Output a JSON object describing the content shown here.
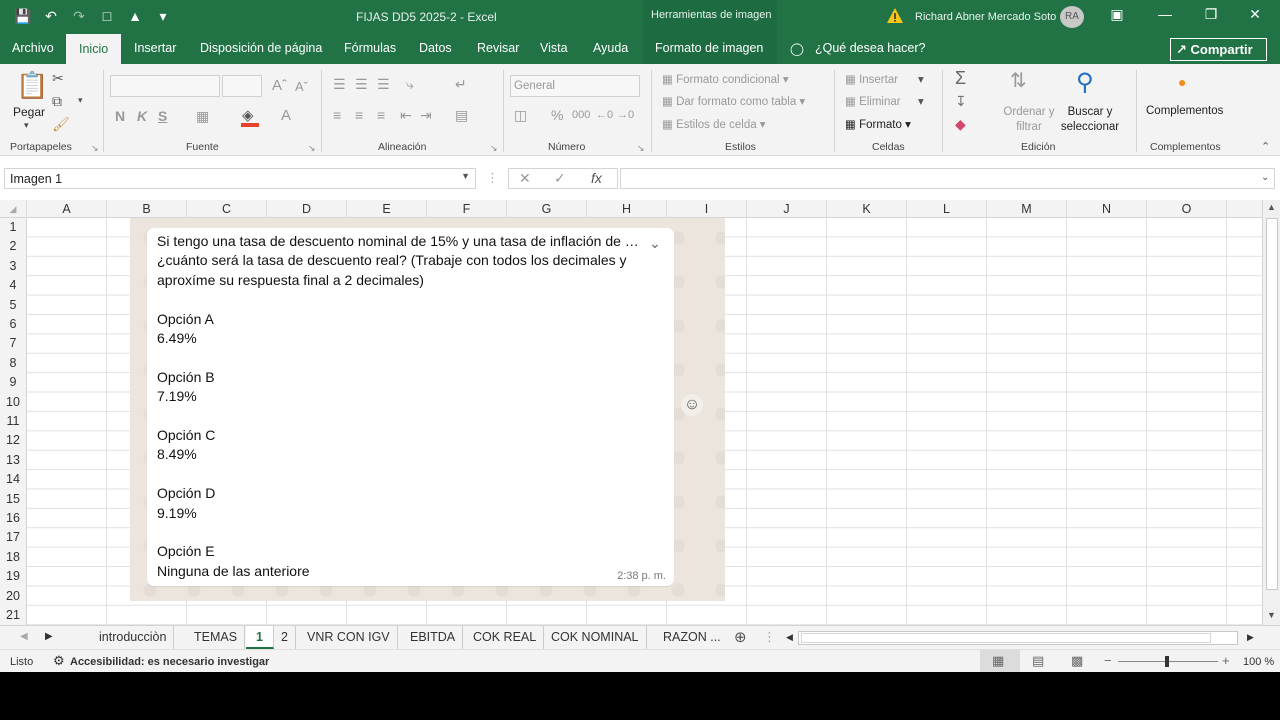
{
  "title_bar": {
    "document_title": "FIJAS DD5 2025-2  -  Excel",
    "contextual_tools": "Herramientas de imagen",
    "user_name": "Richard  Abner Mercado Soto",
    "user_initials": "RA"
  },
  "ribbon_tabs": [
    "Archivo",
    "Inicio",
    "Insertar",
    "Disposición de página",
    "Fórmulas",
    "Datos",
    "Revisar",
    "Vista",
    "Ayuda",
    "Formato de imagen"
  ],
  "tell_me": "¿Qué desea hacer?",
  "share_label": "Compartir",
  "ribbon": {
    "paste_label": "Pegar",
    "font_box": "",
    "number_format": "General",
    "styles": {
      "conditional": "Formato condicional",
      "as_table": "Dar formato como tabla",
      "cell_styles": "Estilos de celda"
    },
    "cells": {
      "insert": "Insertar",
      "delete": "Eliminar",
      "format": "Formato"
    },
    "editing": {
      "sort": "Ordenar y filtrar",
      "find": "Buscar y seleccionar"
    },
    "addins": "Complementos",
    "groups": [
      "Portapapeles",
      "Fuente",
      "Alineación",
      "Número",
      "Estilos",
      "Celdas",
      "Edición",
      "Complementos"
    ]
  },
  "formula_bar": {
    "name_box": "Imagen 1",
    "formula": ""
  },
  "columns": [
    "A",
    "B",
    "C",
    "D",
    "E",
    "F",
    "G",
    "H",
    "I",
    "J",
    "K",
    "L",
    "M",
    "N",
    "O"
  ],
  "rows": [
    "1",
    "2",
    "3",
    "4",
    "5",
    "6",
    "7",
    "8",
    "9",
    "10",
    "11",
    "12",
    "13",
    "14",
    "15",
    "16",
    "17",
    "18",
    "19",
    "20",
    "21"
  ],
  "chat_message": {
    "lines": [
      "Si tengo una tasa de descuento nominal de 15% y una tasa de inflación de …",
      "¿cuánto será la tasa de descuento real? (Trabaje con todos los decimales y",
      "aproxíme su respuesta final a 2 decimales)",
      "",
      "Opción A",
      "6.49%",
      "",
      "Opción B",
      "7.19%",
      "",
      "Opción C",
      "8.49%",
      "",
      "Opción D",
      "9.19%",
      "",
      "Opción E",
      "Ninguna de las anteriore"
    ],
    "time": "2:38 p. m."
  },
  "sheet_tabs": [
    "introducciòn",
    "TEMAS",
    "1",
    "2",
    "VNR CON IGV",
    "EBITDA",
    "COK REAL",
    "COK NOMINAL",
    "RAZON ..."
  ],
  "active_sheet": "1",
  "status_bar": {
    "ready": "Listo",
    "accessibility": "Accesibilidad: es necesario investigar",
    "zoom": "100 %"
  },
  "colors": {
    "excel_green": "#217346",
    "chat_bg": "#ece5dd"
  }
}
